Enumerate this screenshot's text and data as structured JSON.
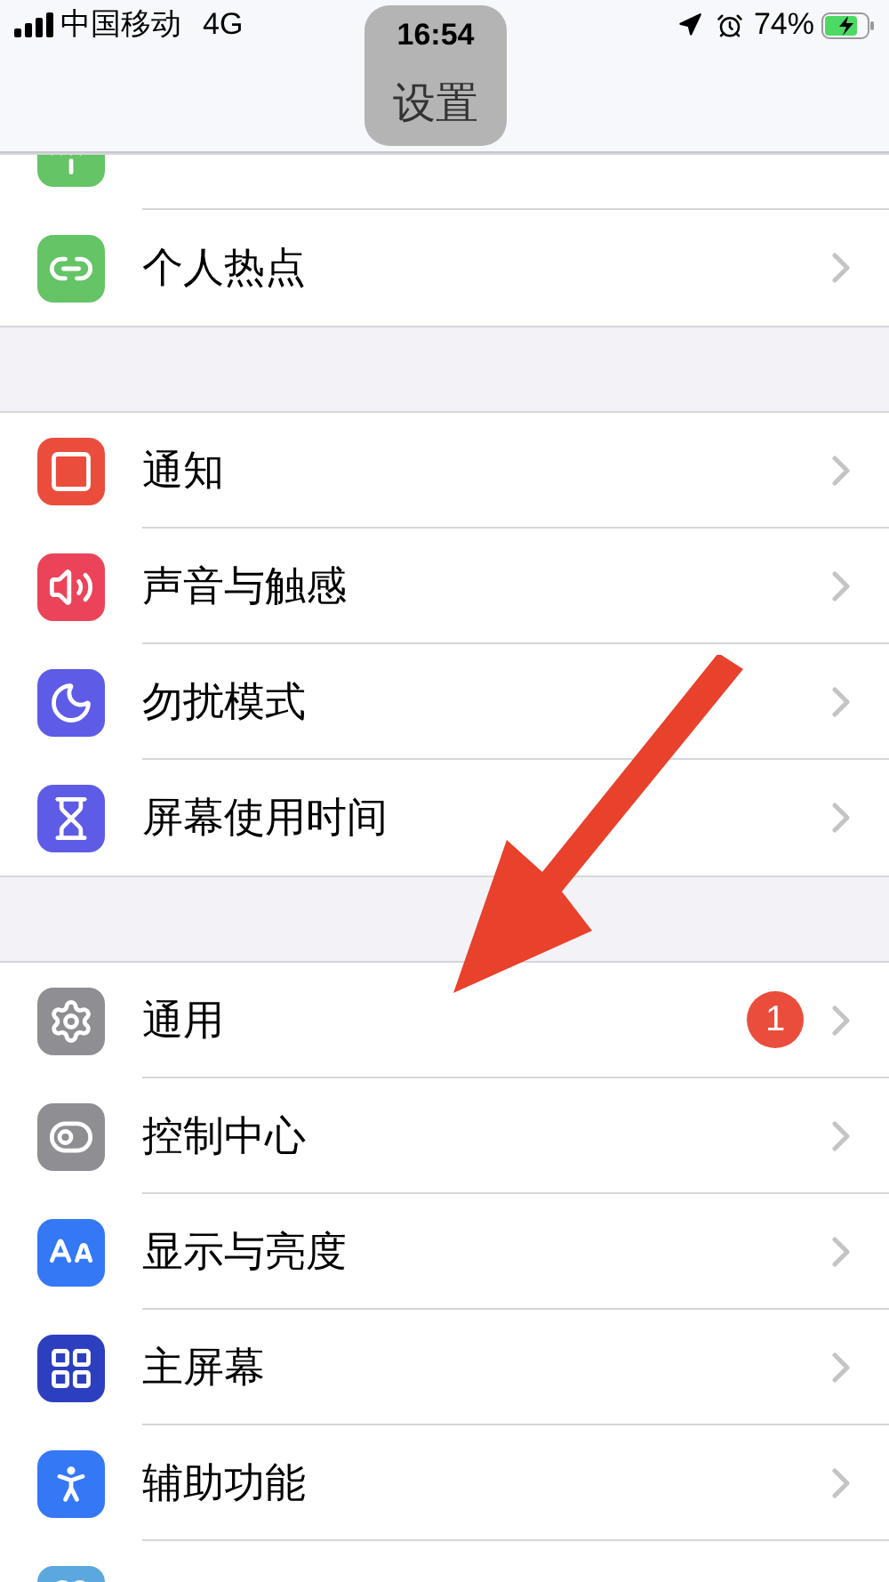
{
  "status_bar": {
    "carrier": "中国移动",
    "network": "4G",
    "time": "16:54",
    "battery": "74%"
  },
  "nav": {
    "title": "设置"
  },
  "groups": [
    {
      "rows": [
        {
          "kind": "cellular",
          "color": "#65c466"
        },
        {
          "kind": "hotspot",
          "label": "个人热点",
          "color": "#65c466"
        }
      ]
    },
    {
      "rows": [
        {
          "kind": "notifications",
          "label": "通知",
          "color": "#eb4d3d"
        },
        {
          "kind": "sounds",
          "label": "声音与触感",
          "color": "#eb445a"
        },
        {
          "kind": "focus",
          "label": "勿扰模式",
          "color": "#5e5ce6"
        },
        {
          "kind": "screentime",
          "label": "屏幕使用时间",
          "color": "#5e5ce6"
        }
      ]
    },
    {
      "rows": [
        {
          "kind": "general",
          "label": "通用",
          "color": "#8e8e93",
          "badge": "1"
        },
        {
          "kind": "control",
          "label": "控制中心",
          "color": "#8e8e93"
        },
        {
          "kind": "display",
          "label": "显示与亮度",
          "color": "#3478f6"
        },
        {
          "kind": "home",
          "label": "主屏幕",
          "color": "#2c3fbf"
        },
        {
          "kind": "accessibility",
          "label": "辅助功能",
          "color": "#3478f6"
        },
        {
          "kind": "wallpaper",
          "color": "#5aa8de"
        }
      ]
    }
  ]
}
